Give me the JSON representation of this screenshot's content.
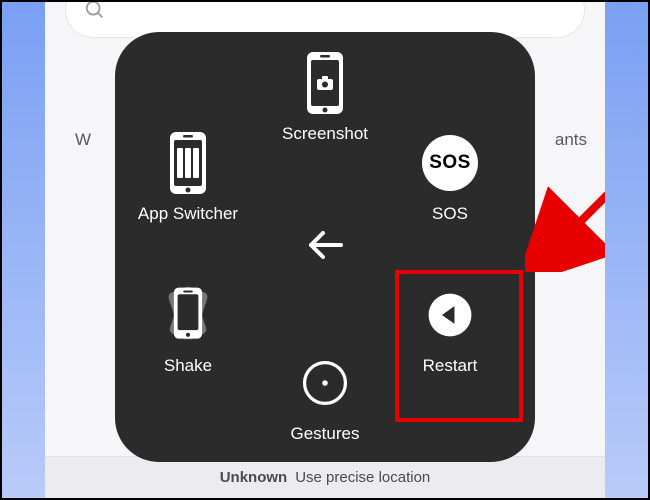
{
  "background": {
    "hint_left": "W",
    "hint_right": "ants",
    "bottom_bold": "Unknown",
    "bottom_rest": "Use precise location"
  },
  "panel": {
    "items": {
      "screenshot": "Screenshot",
      "app_switcher": "App Switcher",
      "sos": "SOS",
      "shake": "Shake",
      "gestures": "Gestures",
      "restart": "Restart"
    },
    "sos_glyph": "SOS"
  },
  "annotation": {
    "highlight_target": "restart"
  }
}
